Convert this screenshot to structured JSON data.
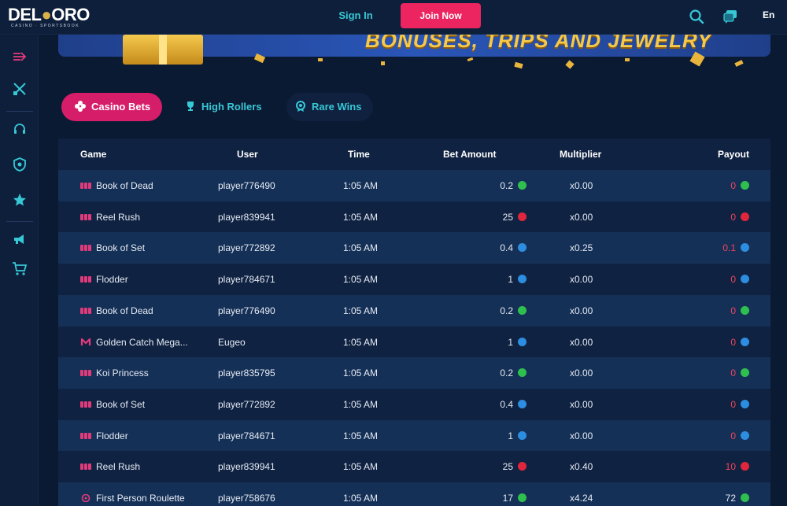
{
  "header": {
    "logo_text_left": "DEL",
    "logo_text_right": "ORO",
    "logo_sub": "CASINO · SPORTSBOOK",
    "signin_label": "Sign In",
    "join_label": "Join Now",
    "lang_label": "En",
    "icons": [
      "search-icon",
      "chat-icon"
    ]
  },
  "sidebar": {
    "items": [
      "expand-arrow-icon",
      "sports-swords-icon",
      "support-headset-icon",
      "shield-icon",
      "star-icon",
      "megaphone-icon",
      "cart-icon"
    ]
  },
  "banner": {
    "text": "BONUSES, TRIPS AND JEWELRY"
  },
  "tabs": [
    {
      "label": "Casino Bets",
      "icon": "dice-icon",
      "active": true
    },
    {
      "label": "High Rollers",
      "icon": "trophy-icon",
      "active": false
    },
    {
      "label": "Rare Wins",
      "icon": "medal-icon",
      "active": false
    }
  ],
  "table": {
    "columns": [
      "Game",
      "User",
      "Time",
      "Bet Amount",
      "Multiplier",
      "Payout"
    ],
    "rows": [
      {
        "game": "Book of Dead",
        "icon": "slot",
        "user": "player776490",
        "time": "1:05 AM",
        "bet": "0.2",
        "bet_coin": "usd",
        "mult": "x0.00",
        "payout": "0",
        "pay_coin": "usd",
        "pay_red": true
      },
      {
        "game": "Reel Rush",
        "icon": "slot",
        "user": "player839941",
        "time": "1:05 AM",
        "bet": "25",
        "bet_coin": "kr",
        "mult": "x0.00",
        "payout": "0",
        "pay_coin": "kr",
        "pay_red": true
      },
      {
        "game": "Book of Set",
        "icon": "slot",
        "user": "player772892",
        "time": "1:05 AM",
        "bet": "0.4",
        "bet_coin": "eur",
        "mult": "x0.25",
        "payout": "0.1",
        "pay_coin": "eur",
        "pay_red": true
      },
      {
        "game": "Flodder",
        "icon": "slot",
        "user": "player784671",
        "time": "1:05 AM",
        "bet": "1",
        "bet_coin": "eur",
        "mult": "x0.00",
        "payout": "0",
        "pay_coin": "eur",
        "pay_red": true
      },
      {
        "game": "Book of Dead",
        "icon": "slot",
        "user": "player776490",
        "time": "1:05 AM",
        "bet": "0.2",
        "bet_coin": "usd",
        "mult": "x0.00",
        "payout": "0",
        "pay_coin": "usd",
        "pay_red": true
      },
      {
        "game": "Golden Catch Mega...",
        "icon": "m",
        "user": "Eugeo",
        "time": "1:05 AM",
        "bet": "1",
        "bet_coin": "eur",
        "mult": "x0.00",
        "payout": "0",
        "pay_coin": "eur",
        "pay_red": true
      },
      {
        "game": "Koi Princess",
        "icon": "slot",
        "user": "player835795",
        "time": "1:05 AM",
        "bet": "0.2",
        "bet_coin": "usd",
        "mult": "x0.00",
        "payout": "0",
        "pay_coin": "usd",
        "pay_red": true
      },
      {
        "game": "Book of Set",
        "icon": "slot",
        "user": "player772892",
        "time": "1:05 AM",
        "bet": "0.4",
        "bet_coin": "eur",
        "mult": "x0.00",
        "payout": "0",
        "pay_coin": "eur",
        "pay_red": true
      },
      {
        "game": "Flodder",
        "icon": "slot",
        "user": "player784671",
        "time": "1:05 AM",
        "bet": "1",
        "bet_coin": "eur",
        "mult": "x0.00",
        "payout": "0",
        "pay_coin": "eur",
        "pay_red": true
      },
      {
        "game": "Reel Rush",
        "icon": "slot",
        "user": "player839941",
        "time": "1:05 AM",
        "bet": "25",
        "bet_coin": "kr",
        "mult": "x0.40",
        "payout": "10",
        "pay_coin": "kr",
        "pay_red": true
      },
      {
        "game": "First Person Roulette",
        "icon": "roulette",
        "user": "player758676",
        "time": "1:05 AM",
        "bet": "17",
        "bet_coin": "usd",
        "mult": "x4.24",
        "payout": "72",
        "pay_coin": "usd",
        "pay_red": false
      }
    ]
  },
  "colors": {
    "accent_pink": "#ec2460",
    "accent_teal": "#37c8d6",
    "loss_red": "#f0455c",
    "coin_usd": "#2fbf4f",
    "coin_kr": "#e0263d",
    "coin_eur": "#2d8de0"
  }
}
